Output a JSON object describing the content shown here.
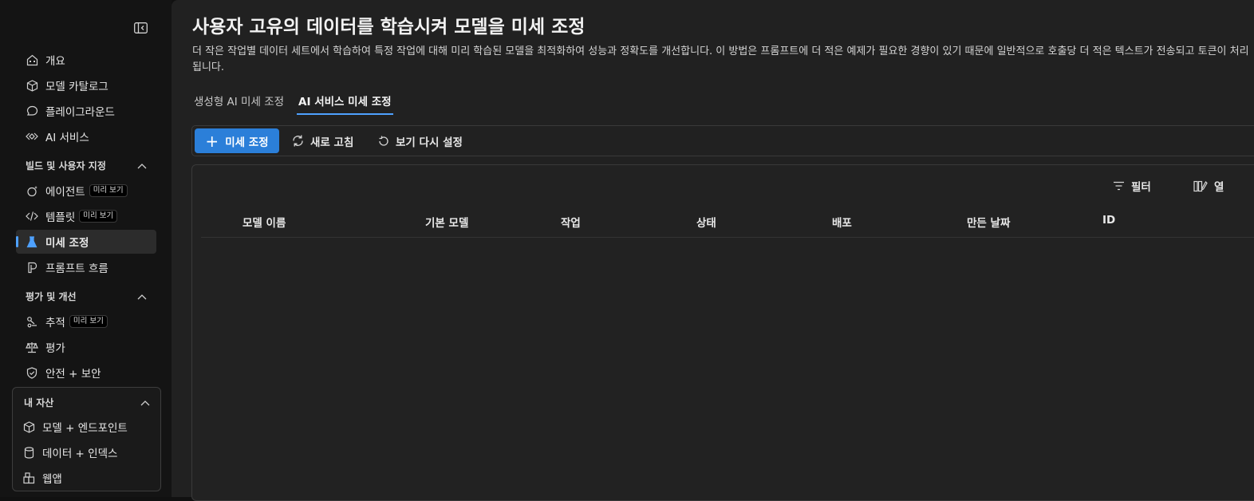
{
  "sidebar": {
    "collapse_label": "",
    "items_top": [
      {
        "label": "개요",
        "icon": "home-icon"
      },
      {
        "label": "모델 카탈로그",
        "icon": "cube-icon"
      },
      {
        "label": "플레이그라운드",
        "icon": "chat-icon"
      },
      {
        "label": "AI 서비스",
        "icon": "link-icon"
      }
    ],
    "section_build": {
      "title": "빌드 및 사용자 지정"
    },
    "items_build": [
      {
        "label": "에이전트",
        "badge": "미리 보기",
        "icon": "agent-icon"
      },
      {
        "label": "템플릿",
        "badge": "미리 보기",
        "icon": "code-icon"
      },
      {
        "label": "미세 조정",
        "icon": "flask-icon"
      },
      {
        "label": "프롬프트 흐름",
        "icon": "flow-icon"
      }
    ],
    "section_eval": {
      "title": "평가 및 개선"
    },
    "items_eval": [
      {
        "label": "추적",
        "badge": "미리 보기",
        "icon": "trace-icon"
      },
      {
        "label": "평가",
        "icon": "scale-icon"
      },
      {
        "label": "안전 + 보안",
        "icon": "shield-icon"
      }
    ],
    "section_mine": {
      "title": "내 자산"
    },
    "items_mine": [
      {
        "label": "모델 + 엔드포인트",
        "icon": "box-icon"
      },
      {
        "label": "데이터 + 인덱스",
        "icon": "database-icon"
      },
      {
        "label": "웹앱",
        "icon": "apps-icon"
      }
    ]
  },
  "main": {
    "title": "사용자 고유의 데이터를 학습시켜 모델을 미세 조정",
    "description": "더 작은 작업별 데이터 세트에서 학습하여 특정 작업에 대해 미리 학습된 모델을 최적화하여 성능과 정확도를 개선합니다. 이 방법은 프롬프트에 더 적은 예제가 필요한 경향이 있기 때문에 일반적으로 호출당 더 적은 텍스트가 전송되고 토큰이 처리됩니다.",
    "tabs": [
      {
        "label": "생성형 AI 미세 조정",
        "active": false
      },
      {
        "label": "AI 서비스 미세 조정",
        "active": true
      }
    ],
    "toolbar": {
      "primary": "미세 조정",
      "refresh": "새로 고침",
      "reset_view": "보기 다시 설정"
    },
    "grid": {
      "filter": "필터",
      "columns_btn": "열",
      "columns": [
        "모델 이름",
        "기본 모델",
        "작업",
        "상태",
        "배포",
        "만든 날짜",
        "ID"
      ]
    }
  },
  "colors": {
    "accent": "#2b7fd9",
    "tab_underline": "#4ea1ff",
    "sidebar_bg": "#141414",
    "main_bg": "#212121"
  }
}
